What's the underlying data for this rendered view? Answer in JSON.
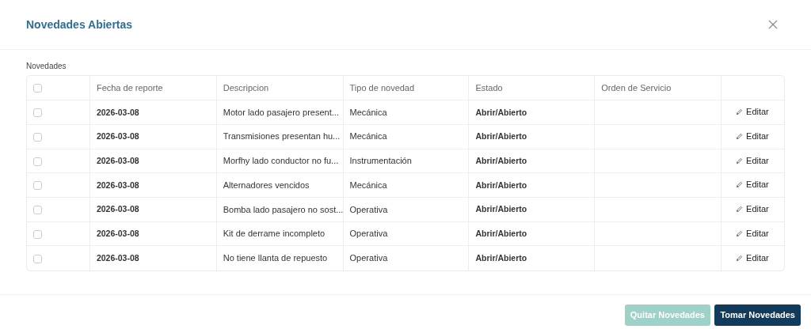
{
  "modal": {
    "title": "Novedades Abiertas"
  },
  "section_label": "Novedades",
  "table": {
    "select_all": {
      "checked": false
    },
    "columns": [
      "Fecha de reporte",
      "Descripcion",
      "Tipo de novedad",
      "Estado",
      "Orden de Servicio"
    ],
    "rows": [
      {
        "checked": false,
        "date": "2026-03-08",
        "description": "Motor lado pasajero present...",
        "type": "Mecánica",
        "status": "Abrir/Abierto",
        "action": "Editar"
      },
      {
        "checked": false,
        "date": "2026-03-08",
        "description": "Transmisiones presentan hu...",
        "type": "Mecánica",
        "status": "Abrir/Abierto",
        "action": "Editar"
      },
      {
        "checked": false,
        "date": "2026-03-08",
        "description": "Morfhy lado conductor no fu...",
        "type": "Instrumentación",
        "status": "Abrir/Abierto",
        "action": "Editar"
      },
      {
        "checked": false,
        "date": "2026-03-08",
        "description": "Alternadores vencidos",
        "type": "Mecánica",
        "status": "Abrir/Abierto",
        "action": "Editar"
      },
      {
        "checked": false,
        "date": "2026-03-08",
        "description": "Bomba lado pasajero no sost...",
        "type": "Operativa",
        "status": "Abrir/Abierto",
        "action": "Editar"
      },
      {
        "checked": false,
        "date": "2026-03-08",
        "description": "Kit de derrame incompleto",
        "type": "Operativa",
        "status": "Abrir/Abierto",
        "action": "Editar"
      },
      {
        "checked": false,
        "date": "2026-03-08",
        "description": "No tiene llanta de repuesto",
        "type": "Operativa",
        "status": "Abrir/Abierto",
        "action": "Editar"
      }
    ]
  },
  "buttons": [
    {
      "label": "Quitar Novedades",
      "kind": "secondary",
      "disabled": true
    },
    {
      "label": "Tomar Novedades",
      "kind": "primary",
      "disabled": false
    }
  ]
}
